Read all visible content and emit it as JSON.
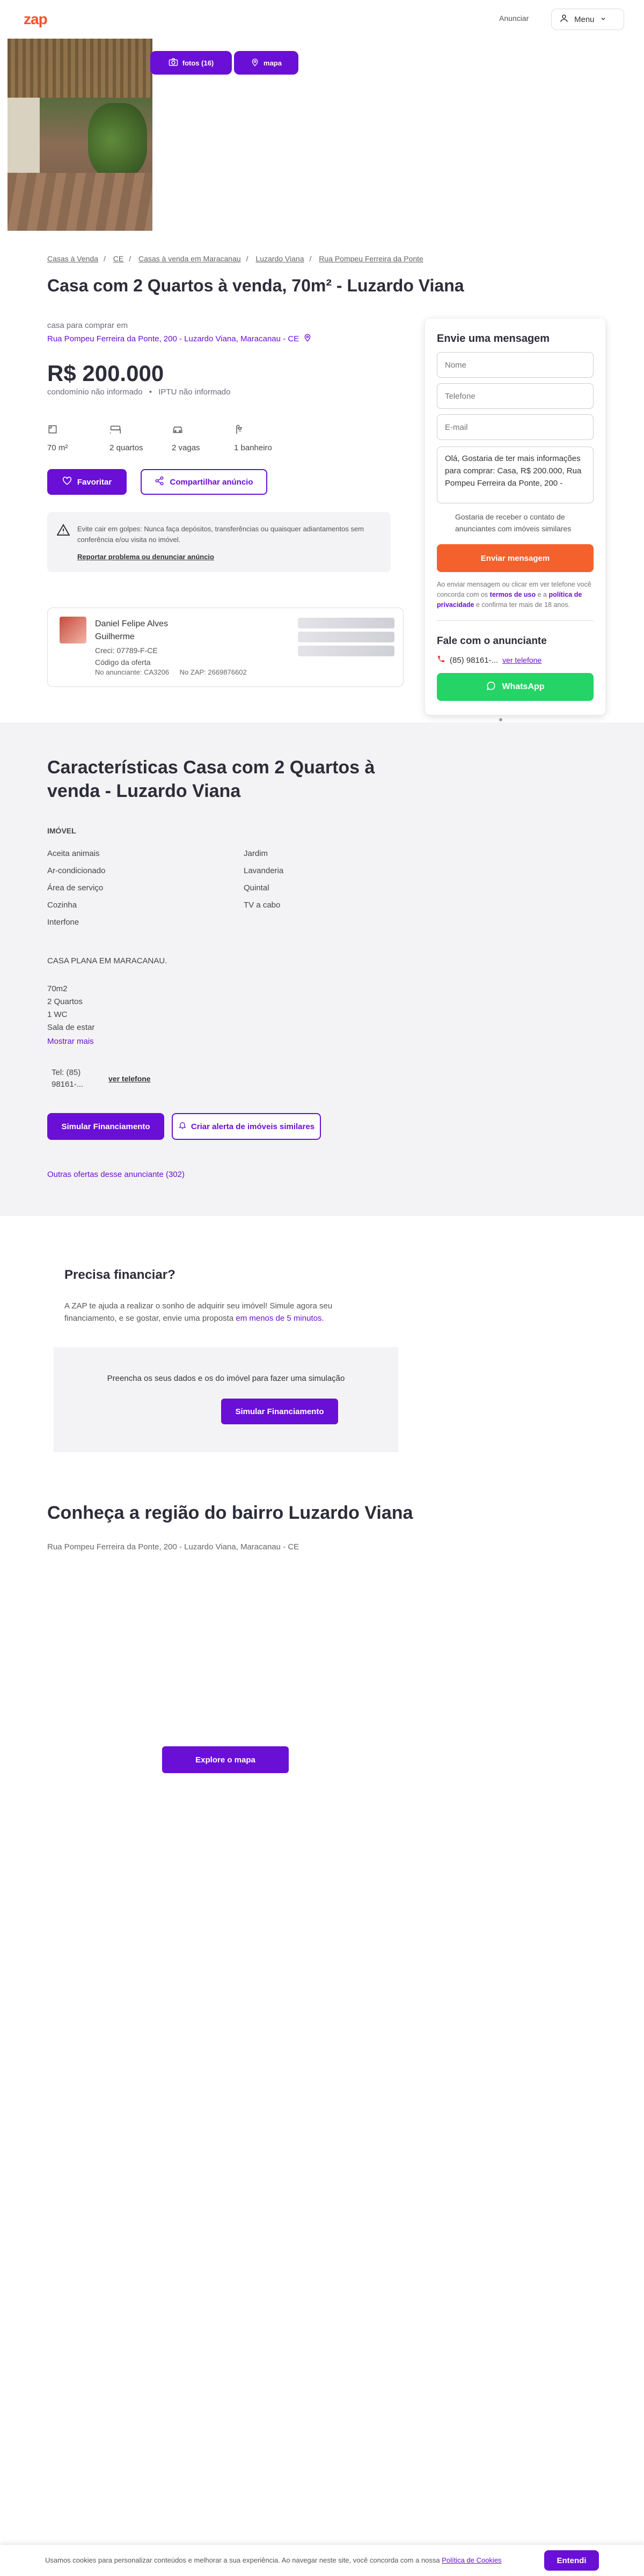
{
  "header": {
    "logo": "zap",
    "anunciar": "Anunciar",
    "menu": "Menu"
  },
  "gallery": {
    "photos_label": "fotos (16)",
    "map_label": "mapa"
  },
  "breadcrumb": [
    "Casas à Venda",
    "CE",
    "Casas à venda em Maracanau",
    "Luzardo Viana",
    "Rua Pompeu Ferreira da Ponte"
  ],
  "listing": {
    "title": "Casa com 2 Quartos à venda, 70m² - Luzardo Viana",
    "for_sale": "casa para comprar em",
    "address": "Rua Pompeu Ferreira da Ponte, 200 - Luzardo Viana, Maracanau - CE",
    "price": "R$ 200.000",
    "condo": "condomínio não informado",
    "iptu": "IPTU não informado",
    "features": [
      {
        "icon": "area-icon",
        "glyph": "▢",
        "label": "70 m²"
      },
      {
        "icon": "bed-icon",
        "glyph": "🛏",
        "label": "2 quartos"
      },
      {
        "icon": "car-icon",
        "glyph": "🚗",
        "label": "2 vagas"
      },
      {
        "icon": "shower-icon",
        "glyph": "🚿",
        "label": "1 banheiro"
      }
    ],
    "favorite": "Favoritar",
    "share": "Compartilhar anúncio"
  },
  "warning": {
    "text": "Evite cair em golpes: Nunca faça depósitos, transferências ou quaisquer adiantamentos sem conferência e/ou visita no imóvel.",
    "report": "Reportar problema ou denunciar anúncio"
  },
  "advertiser": {
    "name_line1": "Daniel Felipe Alves",
    "name_line2": "Guilherme",
    "creci": "Creci: 07789-F-CE",
    "code_label": "Código da oferta",
    "ad_id": "No anunciante: CA3206",
    "zap_id": "No ZAP: 2669876602"
  },
  "contact": {
    "title": "Envie uma mensagem",
    "name_ph": "Nome",
    "phone_ph": "Telefone",
    "email_ph": "E-mail",
    "message": "Olá, Gostaria de ter mais informações para comprar: Casa, R$ 200.000, Rua Pompeu Ferreira da Ponte, 200 -",
    "similar": "Gostaria de receber o contato de anunciantes com imóveis similares",
    "send": "Enviar mensagem",
    "legal_1": "Ao enviar mensagem ou clicar em ver telefone você concorda com os",
    "terms": "termos de uso",
    "legal_2": "e a",
    "privacy": "política de privacidade",
    "legal_3": "e confirma ter mais de 18 anos.",
    "talk_title": "Fale com o anunciante",
    "phone": "(85) 98161-...",
    "see_phone": "ver telefone",
    "whatsapp": "WhatsApp"
  },
  "characteristics": {
    "title": "Características Casa com 2 Quartos à venda - Luzardo Viana",
    "section": "IMÓVEL",
    "left": [
      "Aceita animais",
      "Ar-condicionado",
      "Área de serviço",
      "Cozinha",
      "Interfone"
    ],
    "right": [
      "Jardim",
      "Lavanderia",
      "Quintal",
      "TV a cabo"
    ],
    "desc_headline": "CASA PLANA EM MARACANAU.",
    "desc_lines": [
      "70m2",
      "2 Quartos",
      "1 WC",
      "Sala de estar"
    ],
    "show_more": "Mostrar mais",
    "tel_1": "Tel: (85)",
    "tel_2": "98161-...",
    "see_phone": "ver telefone",
    "simulate": "Simular Financiamento",
    "alert": "Criar alerta de imóveis similares",
    "other_offers": "Outras ofertas desse anunciante (302)"
  },
  "financing": {
    "title": "Precisa financiar?",
    "text": "A ZAP te ajuda a realizar o sonho de adquirir seu imóvel! Simule agora seu financiamento, e se gostar, envie uma proposta",
    "highlight": "em menos de 5 minutos.",
    "box_text": "Preencha os seus dados e os do imóvel para fazer uma simulação",
    "button": "Simular Financiamento"
  },
  "region": {
    "title": "Conheça a região do bairro Luzardo Viana",
    "address": "Rua Pompeu Ferreira da Ponte, 200 - Luzardo Viana, Maracanau - CE",
    "explore": "Explore o mapa"
  },
  "cookie": {
    "text": "Usamos cookies para personalizar conteúdos e melhorar a sua experiência. Ao navegar neste site, você concorda com a nossa",
    "policy": "Política de Cookies",
    "accept": "Entendi"
  },
  "colors": {
    "brand": "#f4512c",
    "primary": "#6a0fd6",
    "send": "#f4612c",
    "whatsapp": "#25d366"
  }
}
